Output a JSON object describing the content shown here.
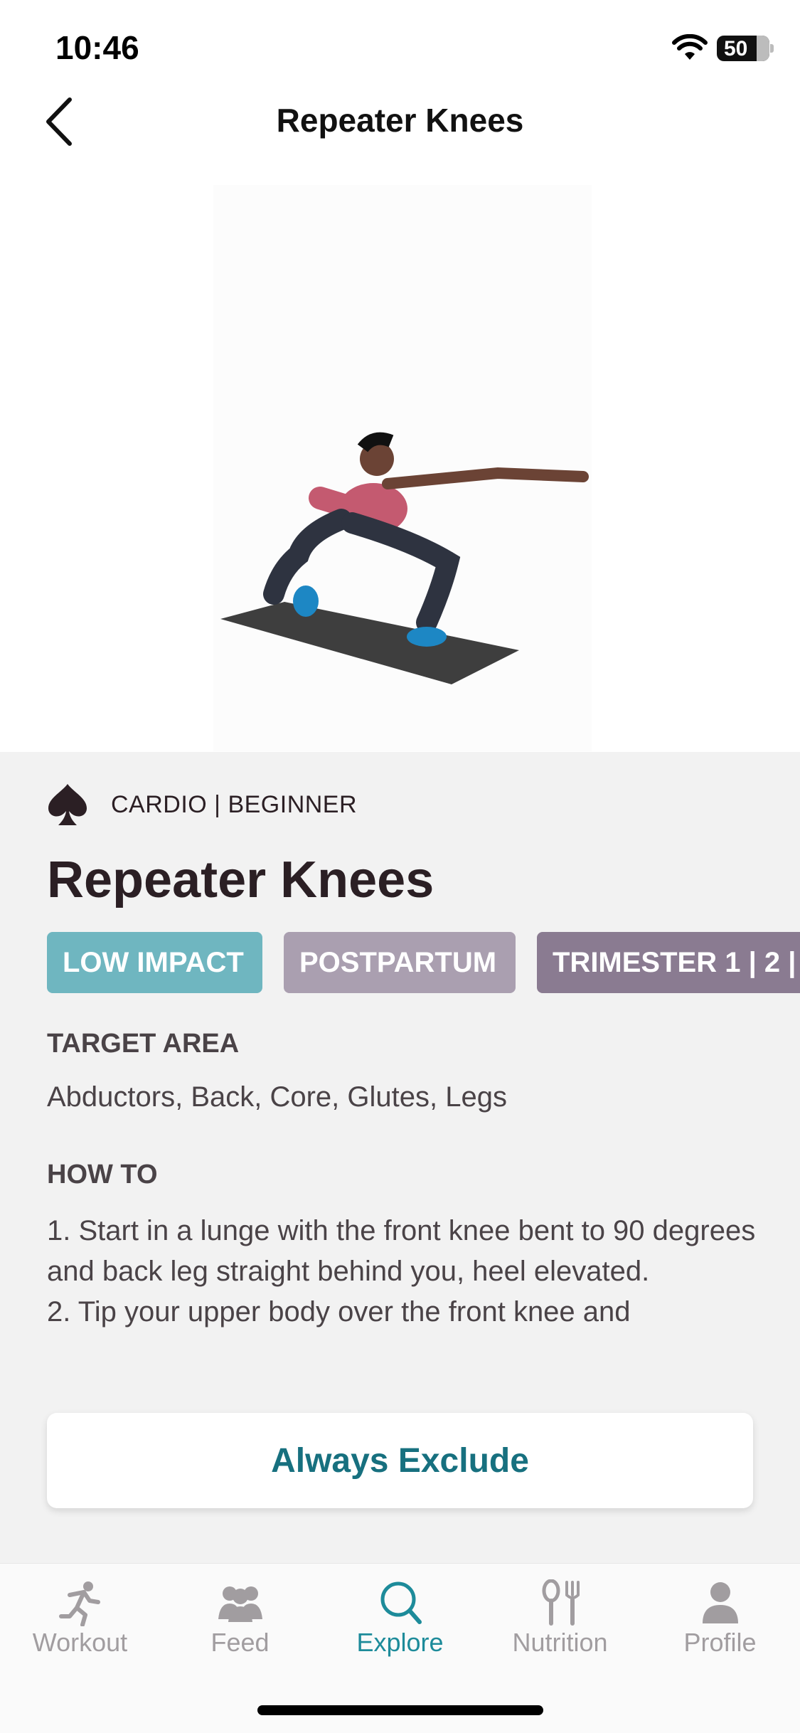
{
  "status_bar": {
    "time": "10:46",
    "battery_level": "50"
  },
  "header": {
    "title": "Repeater Knees",
    "back_icon": "chevron-left-icon"
  },
  "exercise": {
    "category_icon": "spade-icon",
    "category": "CARDIO | BEGINNER",
    "title": "Repeater Knees",
    "tags": [
      {
        "label": "LOW IMPACT",
        "color": "#6fb6c0"
      },
      {
        "label": "POSTPARTUM",
        "color": "#aa9fb0"
      },
      {
        "label": "TRIMESTER 1 | 2 |",
        "color": "#8a7b91"
      }
    ],
    "target_area_label": "TARGET AREA",
    "target_area_value": "Abductors, Back, Core, Glutes, Legs",
    "how_to_label": "HOW TO",
    "how_to_text": "1. Start in a lunge with the front knee bent to 90 degrees and back leg straight behind you, heel elevated.\n2. Tip your upper body over the front knee and",
    "exclude_button": "Always Exclude"
  },
  "tab_bar": {
    "tabs": [
      {
        "label": "Workout",
        "icon": "running-person-icon",
        "active": false
      },
      {
        "label": "Feed",
        "icon": "people-group-icon",
        "active": false
      },
      {
        "label": "Explore",
        "icon": "search-icon",
        "active": true
      },
      {
        "label": "Nutrition",
        "icon": "fork-spoon-icon",
        "active": false
      },
      {
        "label": "Profile",
        "icon": "person-icon",
        "active": false
      }
    ],
    "active_color": "#1d8b9a",
    "inactive_color": "#a19da0"
  }
}
